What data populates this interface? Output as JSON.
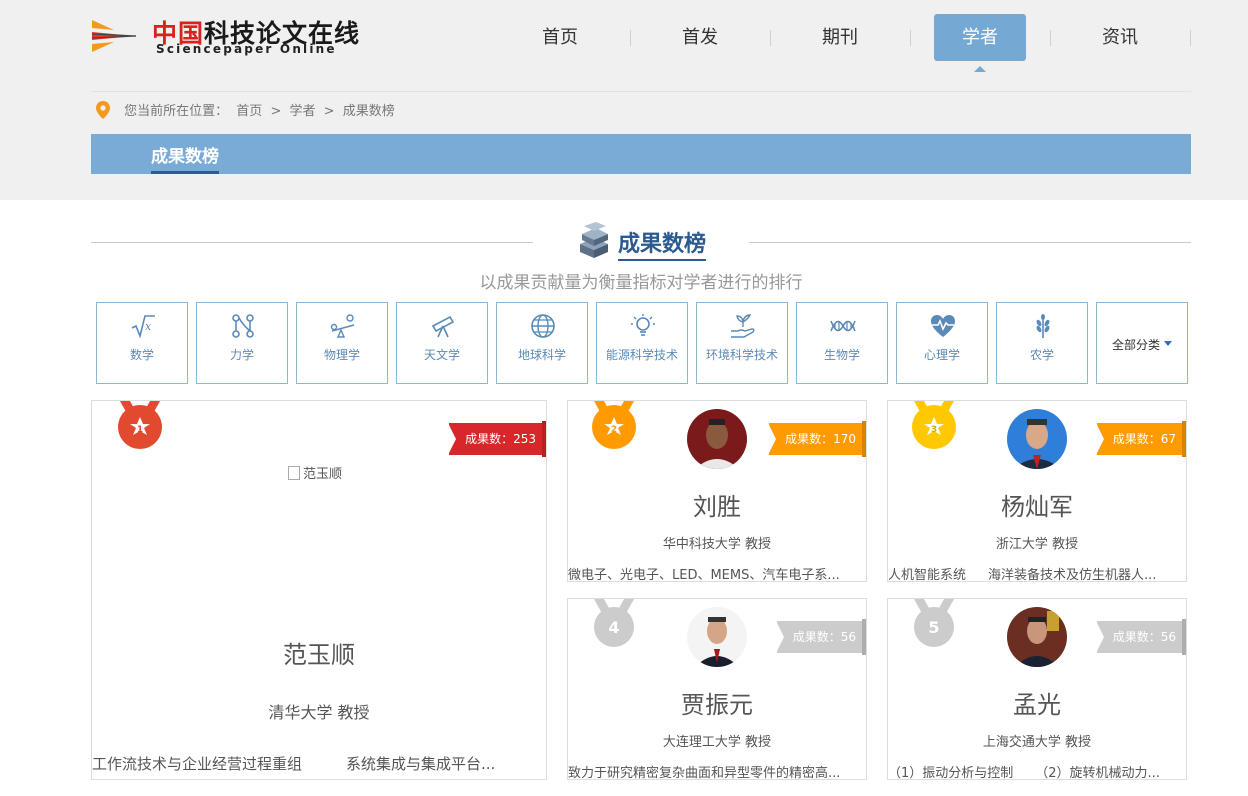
{
  "logo": {
    "cn_red": "中国",
    "cn_black": "科技论文在线",
    "en": "Sciencepaper Online"
  },
  "nav": [
    {
      "label": "首页",
      "active": false
    },
    {
      "label": "首发",
      "active": false
    },
    {
      "label": "期刊",
      "active": false
    },
    {
      "label": "学者",
      "active": true
    },
    {
      "label": "资讯",
      "active": false
    }
  ],
  "breadcrumb": {
    "prefix": "您当前所在位置：",
    "items": [
      "首页",
      ">",
      "学者",
      ">",
      "成果数榜"
    ]
  },
  "tab_bar": {
    "label": "成果数榜"
  },
  "section": {
    "title": "成果数榜",
    "subtitle": "以成果贡献量为衡量指标对学者进行的排行"
  },
  "categories": [
    {
      "label": "数学",
      "icon": "sqrt-icon"
    },
    {
      "label": "力学",
      "icon": "mechanics-icon"
    },
    {
      "label": "物理学",
      "icon": "physics-icon"
    },
    {
      "label": "天文学",
      "icon": "telescope-icon"
    },
    {
      "label": "地球科学",
      "icon": "globe-icon"
    },
    {
      "label": "能源科学技术",
      "icon": "bulb-icon"
    },
    {
      "label": "环境科学技术",
      "icon": "plant-hand-icon"
    },
    {
      "label": "生物学",
      "icon": "dna-icon"
    },
    {
      "label": "心理学",
      "icon": "heart-pulse-icon"
    },
    {
      "label": "农学",
      "icon": "wheat-icon"
    }
  ],
  "all_categories": "全部分类",
  "count_label": "成果数：",
  "colors": {
    "rank1": "#e24a2f",
    "rank2": "#ff9a00",
    "rank3": "#ffc800",
    "rank_other": "#cccccc",
    "ribbon1": "#d8262a",
    "accent": "#76a8d4"
  },
  "scholars": [
    {
      "rank": "1",
      "name": "范玉顺",
      "image_alt": "范玉顺",
      "affiliation": "清华大学 教授",
      "count": "253",
      "keywords": [
        "工作流技术与企业经营过程重组",
        "系统集成与集成平台..."
      ]
    },
    {
      "rank": "2",
      "name": "刘胜",
      "affiliation": "华中科技大学 教授",
      "count": "170",
      "keywords": [
        "微电子、光电子、LED、MEMS、汽车电子系..."
      ]
    },
    {
      "rank": "3",
      "name": "杨灿军",
      "affiliation": "浙江大学 教授",
      "count": "67",
      "keywords": [
        "人机智能系统",
        "海洋装备技术及仿生机器人..."
      ]
    },
    {
      "rank": "4",
      "name": "贾振元",
      "affiliation": "大连理工大学 教授",
      "count": "56",
      "keywords": [
        "致力于研究精密复杂曲面和异型零件的精密高..."
      ]
    },
    {
      "rank": "5",
      "name": "孟光",
      "affiliation": "上海交通大学 教授",
      "count": "56",
      "keywords": [
        "（1）振动分析与控制",
        "（2）旋转机械动力..."
      ]
    }
  ]
}
